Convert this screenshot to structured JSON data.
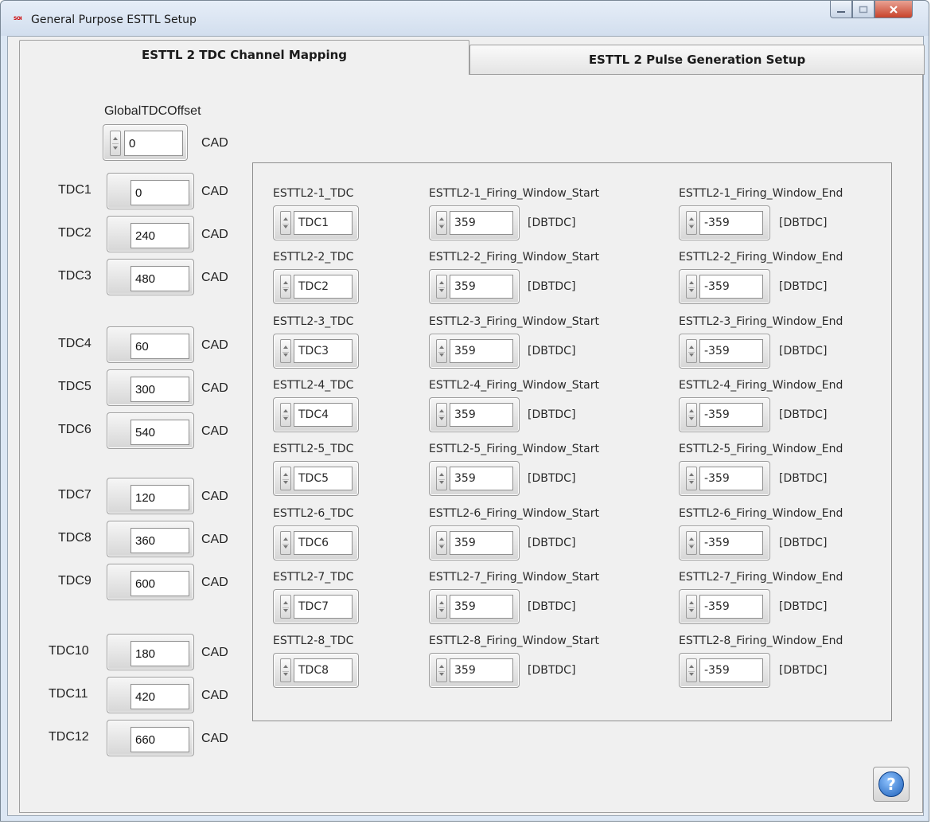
{
  "window": {
    "title": "General Purpose ESTTL Setup",
    "app_icon_text": "SOI"
  },
  "tabs": [
    {
      "label": "ESTTL 2 TDC Channel Mapping",
      "active": true
    },
    {
      "label": "ESTTL 2 Pulse Generation Setup",
      "active": false
    }
  ],
  "global_offset": {
    "label": "GlobalTDCOffset",
    "value": "0",
    "unit": "CAD"
  },
  "tdcs": [
    {
      "label": "TDC1",
      "value": "0",
      "unit": "CAD"
    },
    {
      "label": "TDC2",
      "value": "240",
      "unit": "CAD"
    },
    {
      "label": "TDC3",
      "value": "480",
      "unit": "CAD"
    },
    {
      "label": "TDC4",
      "value": "60",
      "unit": "CAD"
    },
    {
      "label": "TDC5",
      "value": "300",
      "unit": "CAD"
    },
    {
      "label": "TDC6",
      "value": "540",
      "unit": "CAD"
    },
    {
      "label": "TDC7",
      "value": "120",
      "unit": "CAD"
    },
    {
      "label": "TDC8",
      "value": "360",
      "unit": "CAD"
    },
    {
      "label": "TDC9",
      "value": "600",
      "unit": "CAD"
    },
    {
      "label": "TDC10",
      "value": "180",
      "unit": "CAD"
    },
    {
      "label": "TDC11",
      "value": "420",
      "unit": "CAD"
    },
    {
      "label": "TDC12",
      "value": "660",
      "unit": "CAD"
    }
  ],
  "esttl": [
    {
      "tdc_label": "ESTTL2-1_TDC",
      "tdc_value": "TDC1",
      "start_label": "ESTTL2-1_Firing_Window_Start",
      "start_value": "359",
      "start_unit": "[DBTDC]",
      "end_label": "ESTTL2-1_Firing_Window_End",
      "end_value": "-359",
      "end_unit": "[DBTDC]"
    },
    {
      "tdc_label": "ESTTL2-2_TDC",
      "tdc_value": "TDC2",
      "start_label": "ESTTL2-2_Firing_Window_Start",
      "start_value": "359",
      "start_unit": "[DBTDC]",
      "end_label": "ESTTL2-2_Firing_Window_End",
      "end_value": "-359",
      "end_unit": "[DBTDC]"
    },
    {
      "tdc_label": "ESTTL2-3_TDC",
      "tdc_value": "TDC3",
      "start_label": "ESTTL2-3_Firing_Window_Start",
      "start_value": "359",
      "start_unit": "[DBTDC]",
      "end_label": "ESTTL2-3_Firing_Window_End",
      "end_value": "-359",
      "end_unit": "[DBTDC]"
    },
    {
      "tdc_label": "ESTTL2-4_TDC",
      "tdc_value": "TDC4",
      "start_label": "ESTTL2-4_Firing_Window_Start",
      "start_value": "359",
      "start_unit": "[DBTDC]",
      "end_label": "ESTTL2-4_Firing_Window_End",
      "end_value": "-359",
      "end_unit": "[DBTDC]"
    },
    {
      "tdc_label": "ESTTL2-5_TDC",
      "tdc_value": "TDC5",
      "start_label": "ESTTL2-5_Firing_Window_Start",
      "start_value": "359",
      "start_unit": "[DBTDC]",
      "end_label": "ESTTL2-5_Firing_Window_End",
      "end_value": "-359",
      "end_unit": "[DBTDC]"
    },
    {
      "tdc_label": "ESTTL2-6_TDC",
      "tdc_value": "TDC6",
      "start_label": "ESTTL2-6_Firing_Window_Start",
      "start_value": "359",
      "start_unit": "[DBTDC]",
      "end_label": "ESTTL2-6_Firing_Window_End",
      "end_value": "-359",
      "end_unit": "[DBTDC]"
    },
    {
      "tdc_label": "ESTTL2-7_TDC",
      "tdc_value": "TDC7",
      "start_label": "ESTTL2-7_Firing_Window_Start",
      "start_value": "359",
      "start_unit": "[DBTDC]",
      "end_label": "ESTTL2-7_Firing_Window_End",
      "end_value": "-359",
      "end_unit": "[DBTDC]"
    },
    {
      "tdc_label": "ESTTL2-8_TDC",
      "tdc_value": "TDC8",
      "start_label": "ESTTL2-8_Firing_Window_Start",
      "start_value": "359",
      "start_unit": "[DBTDC]",
      "end_label": "ESTTL2-8_Firing_Window_End",
      "end_value": "-359",
      "end_unit": "[DBTDC]"
    }
  ],
  "help_button": {
    "icon": "help-icon",
    "glyph": "?"
  },
  "colors": {
    "titlebar": "#d2deee",
    "close": "#c8432b",
    "help": "#1c5fb8"
  }
}
